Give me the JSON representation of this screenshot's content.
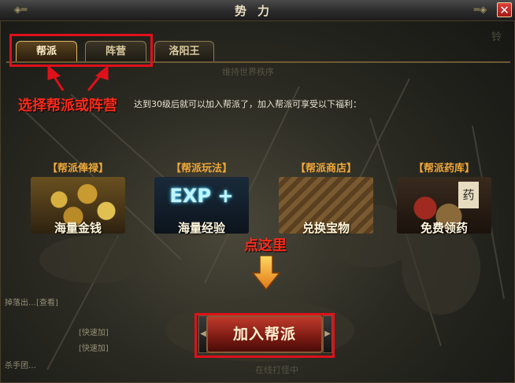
{
  "window": {
    "title": "势力",
    "close_label": "✕"
  },
  "tabs": [
    {
      "label": "帮派",
      "active": true
    },
    {
      "label": "阵营",
      "active": false
    },
    {
      "label": "洛阳王",
      "active": false
    }
  ],
  "annotations": {
    "select_note": "选择帮派或阵营",
    "click_note": "点这里"
  },
  "description": "达到30级后就可以加入帮派了，加入帮派可享受以下福利：",
  "benefits": [
    {
      "header": "【帮派俸禄】",
      "caption": "海量金钱",
      "image": "gold-coins-image"
    },
    {
      "header": "【帮派玩法】",
      "caption": "海量经验",
      "image": "exp-plus-image",
      "image_text": "EXP +"
    },
    {
      "header": "【帮派商店】",
      "caption": "兑换宝物",
      "image": "shop-treasure-image"
    },
    {
      "header": "【帮派药库】",
      "caption": "免费领药",
      "image": "medicine-image",
      "image_text": "药"
    }
  ],
  "join_button": {
    "label": "加入帮派"
  },
  "background_text": {
    "line1": "维持世界秩序",
    "line2": "在线打怪中",
    "side1": "掉落出…[查看]",
    "side2": "[快速加]",
    "side3": "[快速加]",
    "side4": "杀手团…",
    "top_right": "铃"
  },
  "colors": {
    "accent_red": "#e0101a",
    "gold": "#f0a838",
    "tab_border": "#e0b860"
  }
}
